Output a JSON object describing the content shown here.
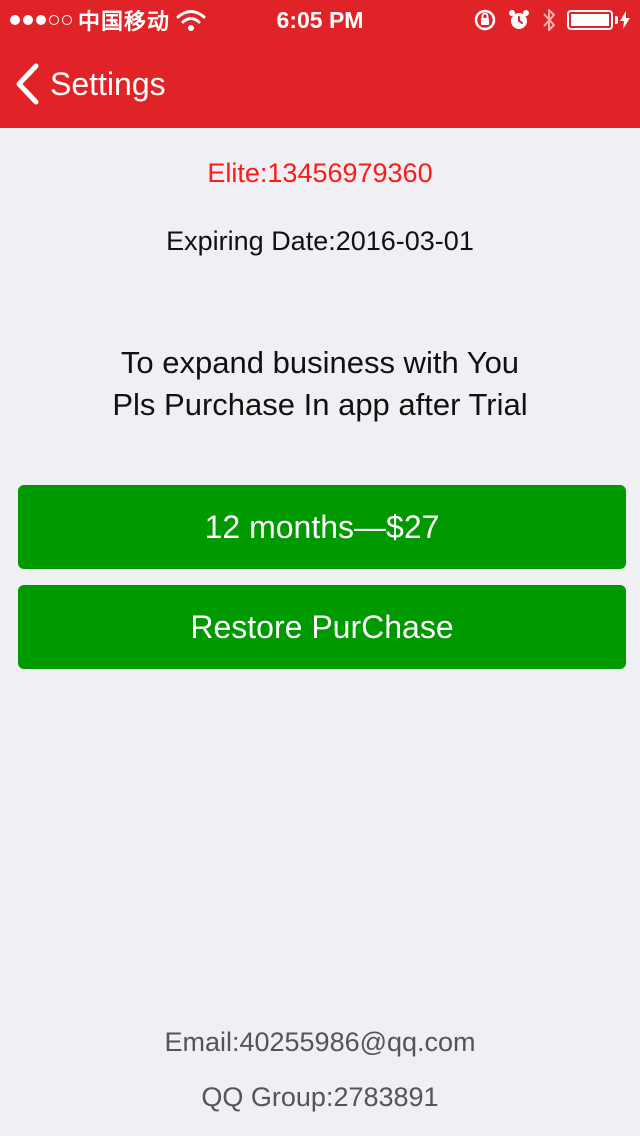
{
  "status_bar": {
    "carrier": "中国移动",
    "time": "6:05 PM",
    "signal_dots_filled": 3,
    "signal_dots_total": 5
  },
  "nav": {
    "back_label": "Settings"
  },
  "account": {
    "elite": "Elite:13456979360",
    "expiry": "Expiring Date:2016-03-01"
  },
  "promo": {
    "line1": "To expand business with You",
    "line2": "Pls Purchase In app after Trial"
  },
  "buttons": {
    "purchase_label": "12 months—$27",
    "restore_label": "Restore PurChase"
  },
  "footer": {
    "email": "Email:40255986@qq.com",
    "qq_group": "QQ Group:2783891"
  },
  "colors": {
    "header_bg": "#e02327",
    "button_bg": "#009a00",
    "elite_text": "#ff1a1a",
    "page_bg": "#efeff4"
  }
}
